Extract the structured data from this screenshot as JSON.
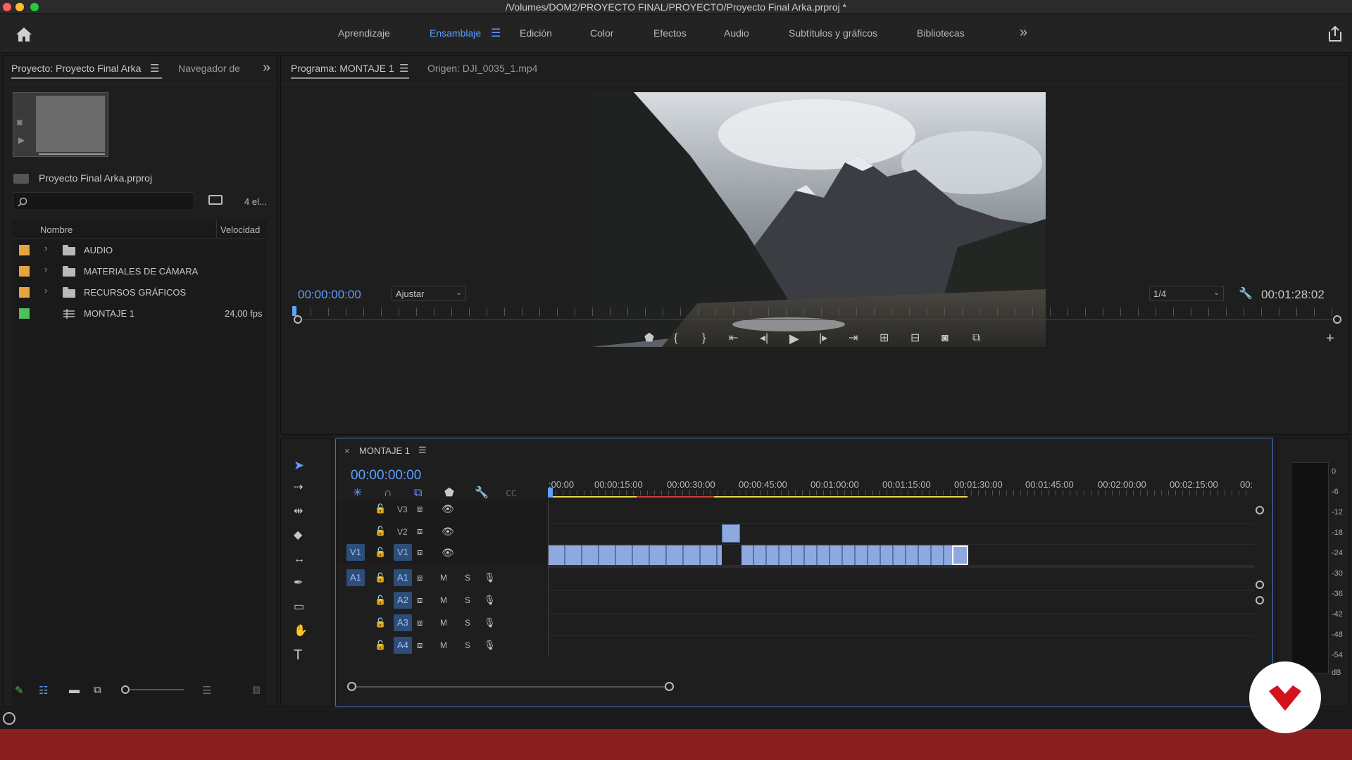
{
  "window": {
    "title": "/Volumes/DOM2/PROYECTO FINAL/PROYECTO/Proyecto Final Arka.prproj *"
  },
  "workspaces": [
    "Aprendizaje",
    "Ensamblaje",
    "Edición",
    "Color",
    "Efectos",
    "Audio",
    "Subtítulos y gráficos",
    "Bibliotecas"
  ],
  "active_workspace": "Ensamblaje",
  "project_panel": {
    "tab_project": "Proyecto: Proyecto Final Arka",
    "tab_navigator": "Navegador de",
    "project_file": "Proyecto Final Arka.prproj",
    "search_placeholder": "",
    "item_count": "4 el...",
    "col_name": "Nombre",
    "col_speed": "Velocidad",
    "items": [
      {
        "name": "AUDIO",
        "type": "folder",
        "speed": "",
        "color": "#e8a33d"
      },
      {
        "name": "MATERIALES DE CÁMARA",
        "type": "folder",
        "speed": "",
        "color": "#e8a33d"
      },
      {
        "name": "RECURSOS GRÁFICOS",
        "type": "folder",
        "speed": "",
        "color": "#e8a33d"
      },
      {
        "name": "MONTAJE 1",
        "type": "sequence",
        "speed": "24,00 fps",
        "color": "#4fbf5a"
      }
    ]
  },
  "program_monitor": {
    "tab_program": "Programa: MONTAJE 1",
    "tab_source": "Origen: DJI_0035_1.mp4",
    "timecode": "00:00:00:00",
    "fit": "Ajustar",
    "resolution": "1/4",
    "duration": "00:01:28:02"
  },
  "timeline": {
    "tab": "MONTAJE 1",
    "timecode": "00:00:00:00",
    "ruler": [
      ":00:00",
      "00:00:15:00",
      "00:00:30:00",
      "00:00:45:00",
      "00:01:00:00",
      "00:01:15:00",
      "00:01:30:00",
      "00:01:45:00",
      "00:02:00:00",
      "00:02:15:00",
      "00:"
    ],
    "video_tracks": [
      "V3",
      "V2",
      "V1"
    ],
    "audio_tracks": [
      "A1",
      "A2",
      "A3",
      "A4"
    ],
    "source_v": "V1",
    "source_a": "A1",
    "mute_label": "M",
    "solo_label": "S"
  },
  "audio_meter": {
    "scale": [
      "0",
      "-6",
      "-12",
      "-18",
      "-24",
      "-30",
      "-36",
      "-42",
      "-48",
      "-54",
      "dB"
    ]
  },
  "colors": {
    "accent": "#5e9fff",
    "clip": "#8ea9e0",
    "bottom_bar": "#8a1f1f",
    "brand": "#d3121b"
  }
}
